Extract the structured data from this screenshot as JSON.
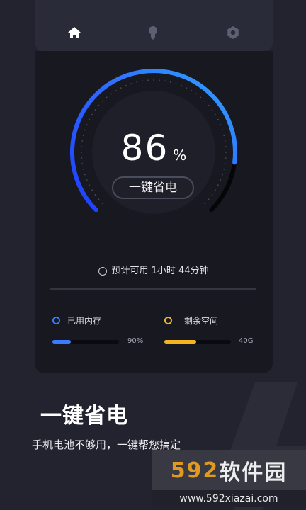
{
  "nav": {
    "items": [
      {
        "icon": "home-icon",
        "active": true
      },
      {
        "icon": "bulb-icon",
        "active": false
      },
      {
        "icon": "gear-icon",
        "active": false
      }
    ]
  },
  "battery": {
    "level": 86,
    "level_text": "86",
    "unit": "%",
    "save_button_label": "一键省电",
    "estimate_text": "预计可用 1小时 44分钟"
  },
  "stats": {
    "memory": {
      "label": "已用内存",
      "value": "90%",
      "fill": 0.28,
      "color": "#3a7bff"
    },
    "storage": {
      "label": "剩余空间",
      "value": "40G",
      "fill": 0.48,
      "color": "#f5b31f"
    }
  },
  "promo": {
    "headline": "一键省电",
    "subline": "手机电池不够用，一键帮您搞定"
  },
  "watermark": {
    "logo_digits": "592",
    "logo_text": "软件园",
    "url": "www.592xiazai.com"
  },
  "colors": {
    "background": "#23232f",
    "card": "#171820",
    "accent_blue": "#2f6bff",
    "accent_cyan": "#2ea6ff",
    "accent_yellow": "#f5b31f"
  }
}
